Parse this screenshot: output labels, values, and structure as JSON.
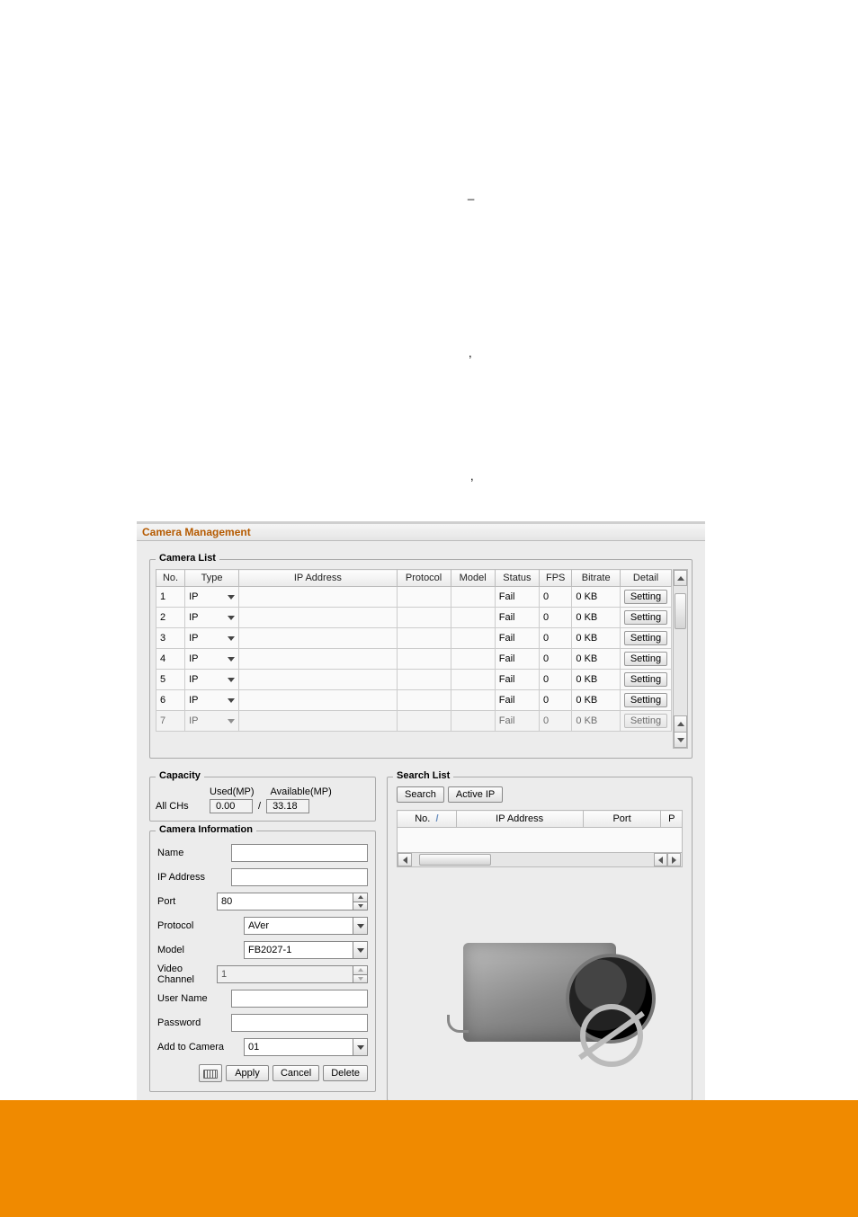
{
  "stray_text": {
    "dash": "_",
    "comma1": ",",
    "link_placeholder": "",
    "comma2": ","
  },
  "dialog": {
    "title": "Camera Management",
    "camera_list": {
      "title": "Camera List",
      "headers": [
        "No.",
        "Type",
        "IP Address",
        "Protocol",
        "Model",
        "Status",
        "FPS",
        "Bitrate",
        "Detail"
      ],
      "rows": [
        {
          "no": "1",
          "type": "IP",
          "ip": "",
          "protocol": "",
          "model": "",
          "status": "Fail",
          "fps": "0",
          "bitrate": "0 KB",
          "detail": "Setting"
        },
        {
          "no": "2",
          "type": "IP",
          "ip": "",
          "protocol": "",
          "model": "",
          "status": "Fail",
          "fps": "0",
          "bitrate": "0 KB",
          "detail": "Setting"
        },
        {
          "no": "3",
          "type": "IP",
          "ip": "",
          "protocol": "",
          "model": "",
          "status": "Fail",
          "fps": "0",
          "bitrate": "0 KB",
          "detail": "Setting"
        },
        {
          "no": "4",
          "type": "IP",
          "ip": "",
          "protocol": "",
          "model": "",
          "status": "Fail",
          "fps": "0",
          "bitrate": "0 KB",
          "detail": "Setting"
        },
        {
          "no": "5",
          "type": "IP",
          "ip": "",
          "protocol": "",
          "model": "",
          "status": "Fail",
          "fps": "0",
          "bitrate": "0 KB",
          "detail": "Setting"
        },
        {
          "no": "6",
          "type": "IP",
          "ip": "",
          "protocol": "",
          "model": "",
          "status": "Fail",
          "fps": "0",
          "bitrate": "0 KB",
          "detail": "Setting"
        },
        {
          "no": "7",
          "type": "IP",
          "ip": "",
          "protocol": "",
          "model": "",
          "status": "Fail",
          "fps": "0",
          "bitrate": "0 KB",
          "detail": "Setting"
        }
      ]
    },
    "capacity": {
      "title": "Capacity",
      "used_label": "Used(MP)",
      "available_label": "Available(MP)",
      "all_chs_label": "All CHs",
      "used_value": "0.00",
      "slash": "/",
      "available_value": "33.18"
    },
    "camera_info": {
      "title": "Camera Information",
      "name_label": "Name",
      "name_value": "",
      "ip_label": "IP Address",
      "ip_value": "",
      "port_label": "Port",
      "port_value": "80",
      "protocol_label": "Protocol",
      "protocol_value": "AVer",
      "model_label": "Model",
      "model_value": "FB2027-1",
      "video_channel_label": "Video Channel",
      "video_channel_value": "1",
      "user_label": "User Name",
      "user_value": "",
      "password_label": "Password",
      "password_value": "",
      "add_to_camera_label": "Add to Camera",
      "add_to_camera_value": "01",
      "apply_btn": "Apply",
      "cancel_btn": "Cancel",
      "delete_btn": "Delete"
    },
    "search_list": {
      "title": "Search List",
      "search_btn": "Search",
      "active_ip_btn": "Active IP",
      "headers": [
        "No.",
        "IP Address",
        "Port",
        "P"
      ],
      "sort_indicator": "/"
    }
  }
}
